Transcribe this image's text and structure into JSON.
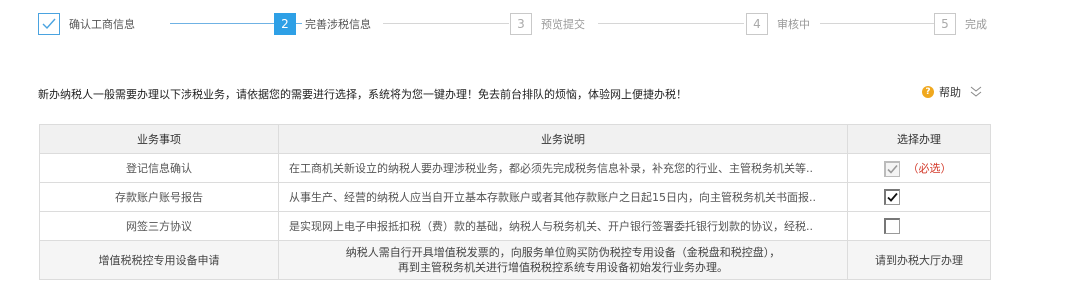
{
  "steps": [
    {
      "number": "",
      "label": "确认工商信息",
      "state": "done"
    },
    {
      "number": "2",
      "label": "完善涉税信息",
      "state": "active"
    },
    {
      "number": "3",
      "label": "预览提交",
      "state": "pending"
    },
    {
      "number": "4",
      "label": "审核中",
      "state": "pending"
    },
    {
      "number": "5",
      "label": "完成",
      "state": "pending"
    }
  ],
  "intro": "新办纳税人一般需要办理以下涉税业务，请依据您的需要进行选择，系统将为您一键办理！免去前台排队的烦恼，体验网上便捷办税！",
  "help": {
    "label": "帮助",
    "icon": "question-icon"
  },
  "table": {
    "headers": [
      "业务事项",
      "业务说明",
      "选择办理"
    ],
    "rows": [
      {
        "item": "登记信息确认",
        "desc": "在工商机关新设立的纳税人要办理涉税业务，都必须先完成税务信息补录，补充您的行业、主管税务机关等..",
        "checked": true,
        "disabled": true,
        "note": "（必选）"
      },
      {
        "item": "存款账户账号报告",
        "desc": "从事生产、经营的纳税人应当自开立基本存款账户或者其他存款账户之日起15日内，向主管税务机关书面报..",
        "checked": true,
        "disabled": false,
        "note": ""
      },
      {
        "item": "网签三方协议",
        "desc": "是实现网上电子申报抵扣税（费）款的基础，纳税人与税务机关、开户银行签署委托银行划款的协议，经税..",
        "checked": false,
        "disabled": false,
        "note": ""
      }
    ],
    "special": {
      "item": "增值税税控专用设备申请",
      "desc_line1": "纳税人需自行开具增值税发票的，向服务单位购买防伪税控专用设备（金税盘和税控盘），",
      "desc_line2": "再到主管税务机关进行增值税税控系统专用设备初始发行业务办理。",
      "action": "请到办税大厅办理"
    }
  }
}
